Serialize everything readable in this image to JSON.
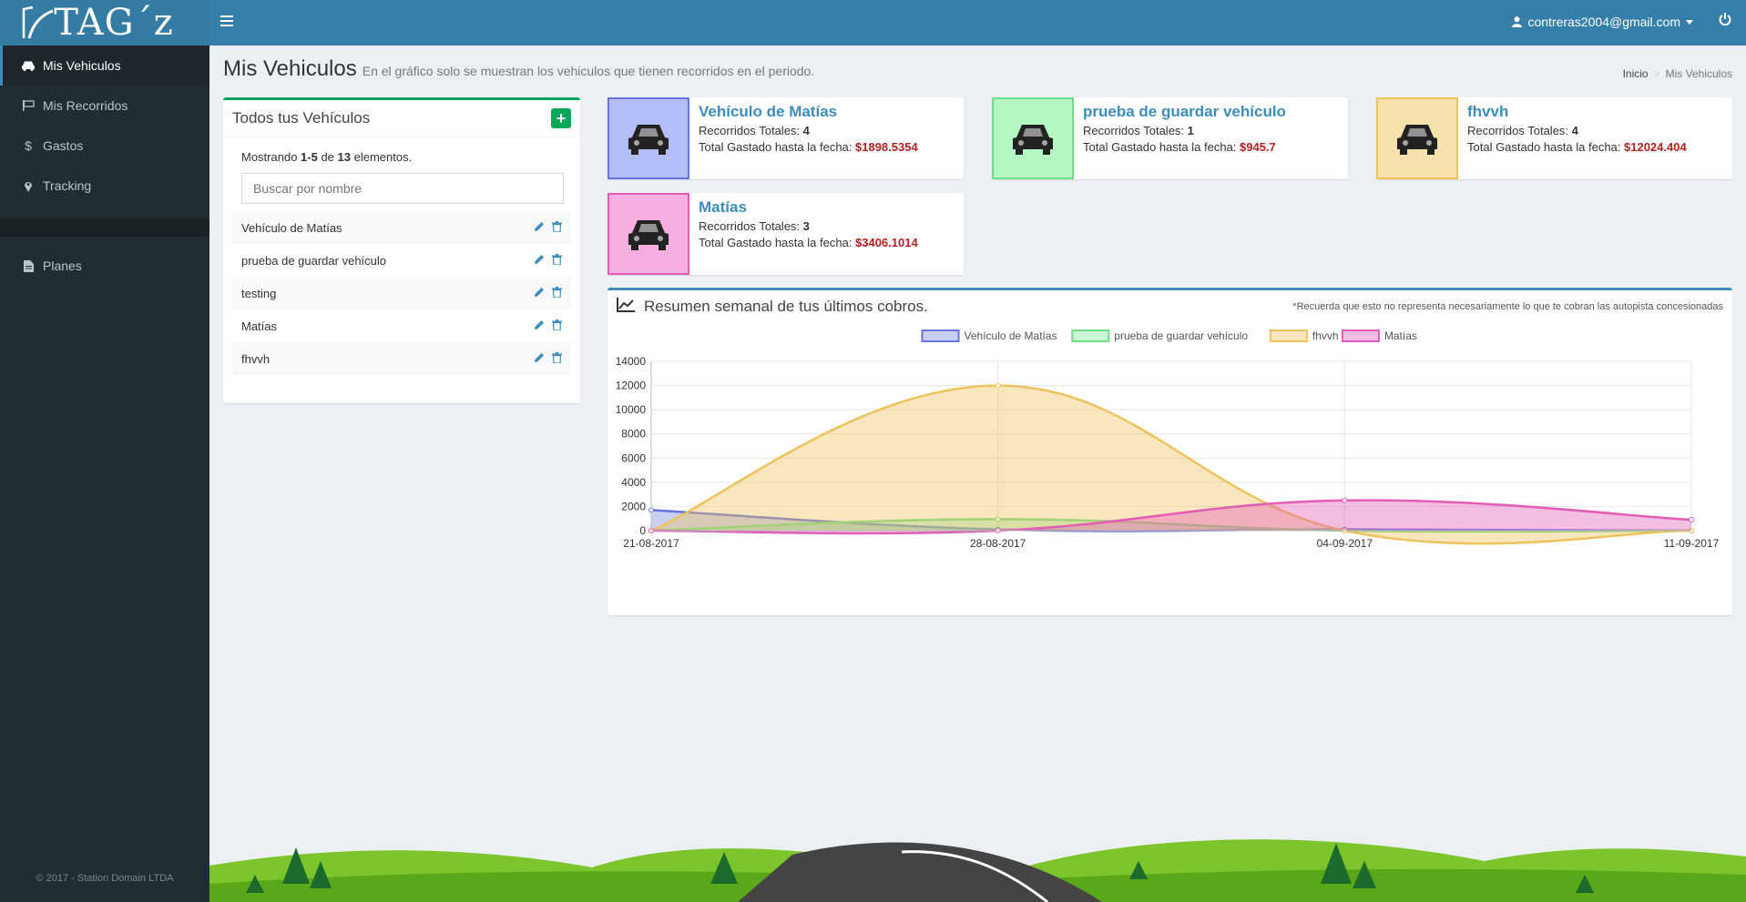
{
  "app": {
    "logo_text": "TAG´z"
  },
  "header": {
    "user_email": "contreras2004@gmail.com"
  },
  "sidebar": {
    "items": [
      {
        "label": "Mis Vehiculos",
        "icon": "car-icon",
        "active": true
      },
      {
        "label": "Mis Recorridos",
        "icon": "flag-icon",
        "active": false
      },
      {
        "label": "Gastos",
        "icon": "dollar-icon",
        "active": false
      },
      {
        "label": "Tracking",
        "icon": "map-marker-icon",
        "active": false
      }
    ],
    "items2": [
      {
        "label": "Planes",
        "icon": "file-icon"
      }
    ],
    "footer": "© 2017 - Station Domain LTDA"
  },
  "page": {
    "title": "Mis Vehiculos",
    "subtitle": "En el gráfico solo se muestran los vehiculos que tienen recorridos en el periodo.",
    "breadcrumb": [
      "Inicio",
      "Mis Vehiculos"
    ]
  },
  "vehicles_box": {
    "title": "Todos tus Vehículos",
    "showing_prefix": "Mostrando ",
    "showing_range": "1-5",
    "showing_mid": " de ",
    "showing_total": "13",
    "showing_suffix": " elementos.",
    "search_placeholder": "Buscar por nombre",
    "rows": [
      "Vehículo de Matías",
      "prueba de guardar vehículo",
      "testing",
      "Matías",
      "fhvvh"
    ]
  },
  "cards": [
    {
      "name": "Vehículo de Matías",
      "trips_label": "Recorridos Totales: ",
      "trips": "4",
      "spent_label": "Total Gastado hasta la fecha: ",
      "spent": "$1898.5354",
      "bg": "#b3bdf7",
      "border": "#6675e0"
    },
    {
      "name": "prueba de guardar vehículo",
      "trips_label": "Recorridos Totales: ",
      "trips": "1",
      "spent_label": "Total Gastado hasta la fecha: ",
      "spent": "$945.7",
      "bg": "#b5f7c3",
      "border": "#6fdc86"
    },
    {
      "name": "fhvvh",
      "trips_label": "Recorridos Totales: ",
      "trips": "4",
      "spent_label": "Total Gastado hasta la fecha: ",
      "spent": "$12024.404",
      "bg": "#f7e2ad",
      "border": "#eec25c"
    },
    {
      "name": "Matías",
      "trips_label": "Recorridos Totales: ",
      "trips": "3",
      "spent_label": "Total Gastado hasta la fecha: ",
      "spent": "$3406.1014",
      "bg": "#f7aee0",
      "border": "#e35cb6"
    }
  ],
  "chart_box": {
    "title": "Resumen semanal de tus últimos cobros.",
    "note": "*Recuerda que esto no representa necesariamente lo que te cobran las autopista concesionadas"
  },
  "chart_data": {
    "type": "area",
    "categories": [
      "21-08-2017",
      "28-08-2017",
      "04-09-2017",
      "11-09-2017"
    ],
    "ylim": [
      0,
      14000
    ],
    "yticks": [
      0,
      2000,
      4000,
      6000,
      8000,
      10000,
      12000,
      14000
    ],
    "legend_position": "top",
    "grid": true,
    "series": [
      {
        "name": "Vehículo de Matías",
        "values": [
          1700,
          100,
          100,
          0
        ],
        "stroke": "#6675e0",
        "fill": "rgba(102,117,224,0.35)"
      },
      {
        "name": "prueba de guardar vehículo",
        "values": [
          0,
          950,
          0,
          0
        ],
        "stroke": "#6fdc86",
        "fill": "rgba(111,220,134,0.35)"
      },
      {
        "name": "fhvvh",
        "values": [
          0,
          12000,
          0,
          0
        ],
        "stroke": "#eec25c",
        "fill": "rgba(238,194,92,0.4)"
      },
      {
        "name": "Matías",
        "values": [
          0,
          0,
          2500,
          900
        ],
        "stroke": "#e35cb6",
        "fill": "rgba(227,92,182,0.4)"
      }
    ]
  }
}
